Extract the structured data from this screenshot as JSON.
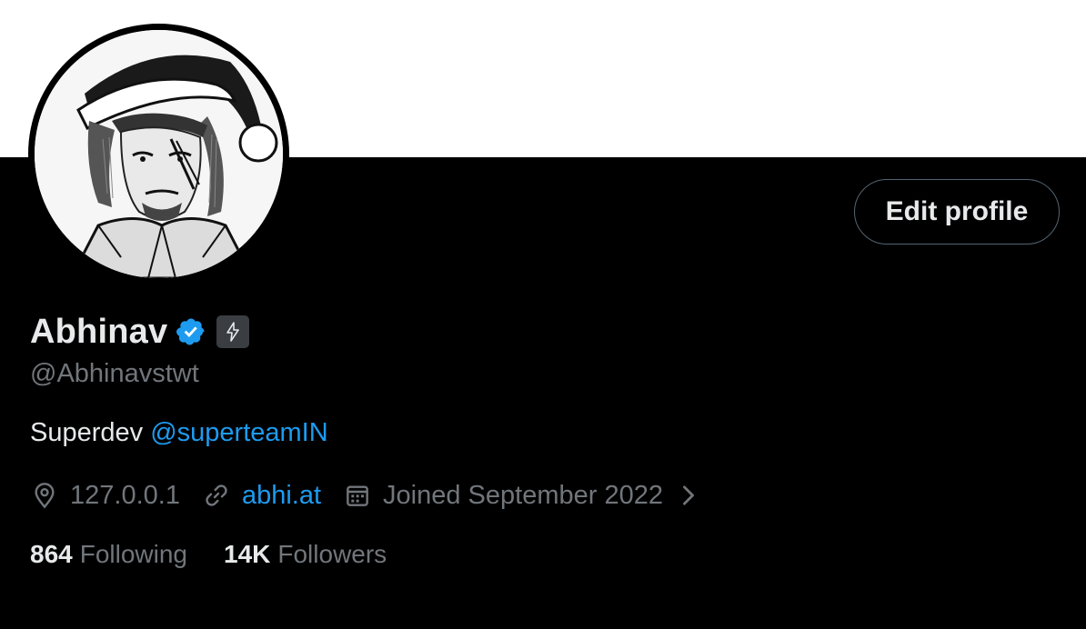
{
  "profile": {
    "name": "Abhinav",
    "handle": "@Abhinavstwt",
    "bio_text": "Superdev",
    "bio_mention": "@superteamIN",
    "location": "127.0.0.1",
    "website": "abhi.at",
    "joined": "Joined September 2022",
    "following_count": "864",
    "following_label": "Following",
    "followers_count": "14K",
    "followers_label": "Followers"
  },
  "actions": {
    "edit_profile_label": "Edit profile"
  },
  "icons": {
    "verified": "verified-badge-icon",
    "badge": "lightning-badge-icon",
    "location": "location-pin-icon",
    "link": "link-icon",
    "calendar": "calendar-icon",
    "chevron": "chevron-right-icon"
  },
  "colors": {
    "background": "#000000",
    "banner": "#ffffff",
    "primary_text": "#e7e9ea",
    "secondary_text": "#71767b",
    "accent": "#1d9bf0"
  }
}
